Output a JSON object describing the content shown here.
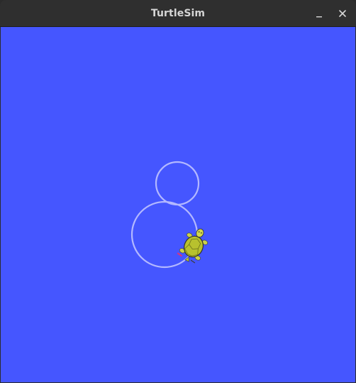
{
  "window": {
    "title": "TurtleSim"
  },
  "titlebar": {
    "minimize_icon": "minimize-icon",
    "close_icon": "close-icon"
  },
  "canvas": {
    "background_color": "#4556ff",
    "pen_color": "#b3b8ff",
    "turtle_shell_color": "#b8c12e",
    "turtle_head_color": "#d2d84e"
  }
}
